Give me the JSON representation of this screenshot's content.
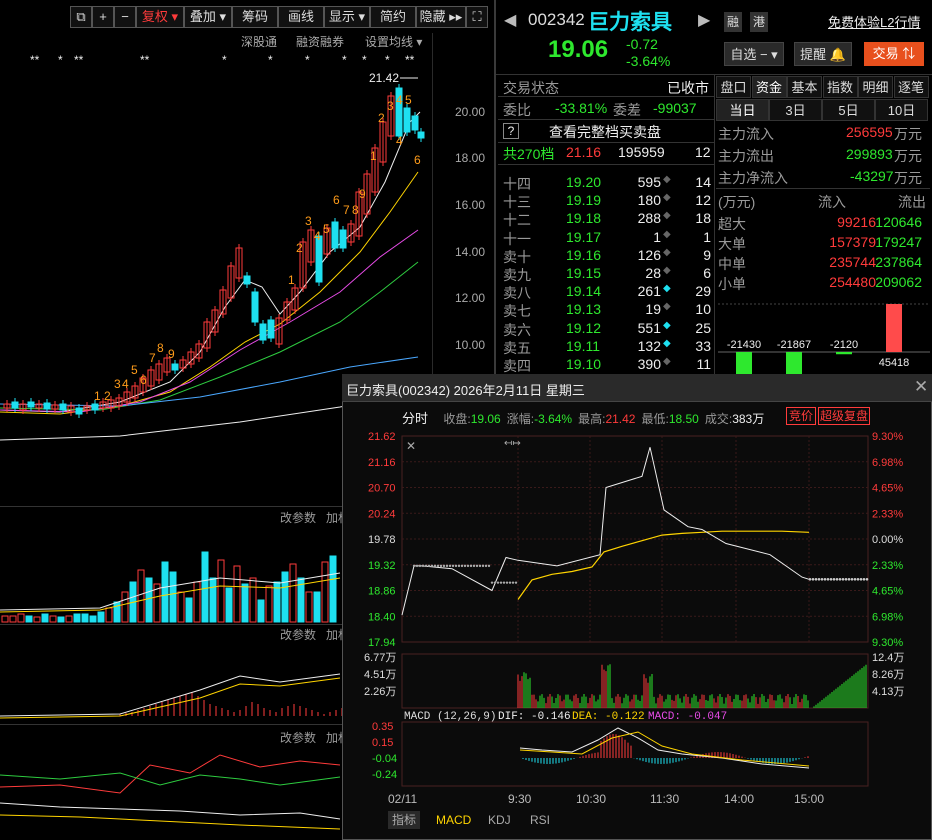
{
  "toolbar": {
    "buttons": [
      "复权",
      "叠加",
      "筹码",
      "画线",
      "显示",
      "简约",
      "隐藏"
    ],
    "sub": [
      "深股通",
      "融资融券",
      "设置均线"
    ]
  },
  "stars": [
    "**",
    "*",
    "**",
    "**",
    "*",
    "*",
    "*",
    "*",
    "*",
    "*",
    "**"
  ],
  "kline": {
    "high_label": "21.42",
    "prices": [
      "20.00",
      "18.00",
      "16.00",
      "14.00",
      "12.00",
      "10.00"
    ],
    "nums_up": [
      "1",
      "2",
      "3",
      "4",
      "5",
      "6",
      "7",
      "8",
      "9"
    ],
    "nums_top": [
      "1",
      "2",
      "3",
      "4",
      "5"
    ],
    "nums_side": [
      "4",
      "6"
    ],
    "nums_mid": [
      "1",
      "2",
      "3",
      "4",
      "5",
      "6",
      "7",
      "8",
      "9"
    ]
  },
  "panel_labels": {
    "p1": "改参数",
    "p1b": "加权",
    "p2": "改参数",
    "p2b": "加权",
    "p3": "改参数",
    "p3b": "加权"
  },
  "quote": {
    "code": "002342",
    "name": "巨力索具",
    "tag1": "融",
    "tag2": "港",
    "l2": "免费体验L2行情",
    "price": "19.06",
    "change": "-0.72",
    "pct": "-3.64%",
    "watch": "自选",
    "alert": "提醒",
    "trade": "交易"
  },
  "status": {
    "label": "交易状态",
    "value": "已收市",
    "wb_label": "委比",
    "wb": "-33.81%",
    "wc_label": "委差",
    "wc": "-99037",
    "full": "查看完整档买卖盘",
    "total_label": "共270档",
    "total_price": "21.16",
    "total_vol": "195959",
    "total_cnt": "12"
  },
  "orderbook": [
    {
      "lv": "十四",
      "p": "19.20",
      "v": "595",
      "c": "14"
    },
    {
      "lv": "十三",
      "p": "19.19",
      "v": "180",
      "c": "12"
    },
    {
      "lv": "十二",
      "p": "19.18",
      "v": "288",
      "c": "18"
    },
    {
      "lv": "十一",
      "p": "19.17",
      "v": "1",
      "c": "1"
    },
    {
      "lv": "卖十",
      "p": "19.16",
      "v": "126",
      "c": "9"
    },
    {
      "lv": "卖九",
      "p": "19.15",
      "v": "28",
      "c": "6"
    },
    {
      "lv": "卖八",
      "p": "19.14",
      "v": "261",
      "c": "29"
    },
    {
      "lv": "卖七",
      "p": "19.13",
      "v": "19",
      "c": "10"
    },
    {
      "lv": "卖六",
      "p": "19.12",
      "v": "551",
      "c": "25"
    },
    {
      "lv": "卖五",
      "p": "19.11",
      "v": "132",
      "c": "33"
    },
    {
      "lv": "卖四",
      "p": "19.10",
      "v": "390",
      "c": "11"
    }
  ],
  "right_tabs": [
    "盘口",
    "资金",
    "基本",
    "指数",
    "明细",
    "逐笔"
  ],
  "period_tabs": [
    "当日",
    "3日",
    "5日",
    "10日"
  ],
  "fund": {
    "in_label": "主力流入",
    "in": "256595",
    "out_label": "主力流出",
    "out": "299893",
    "net_label": "主力净流入",
    "net": "-43297",
    "unit": "万元",
    "hdr_unit": "(万元)",
    "hdr_in": "流入",
    "hdr_out": "流出",
    "rows": [
      {
        "k": "超大",
        "i": "99216",
        "o": "120646"
      },
      {
        "k": "大单",
        "i": "157379",
        "o": "179247"
      },
      {
        "k": "中单",
        "i": "235744",
        "o": "237864"
      },
      {
        "k": "小单",
        "i": "254480",
        "o": "209062"
      }
    ],
    "bars": [
      {
        "v": "-21430"
      },
      {
        "v": "-21867"
      },
      {
        "v": "-2120"
      },
      {
        "v": "45418"
      }
    ]
  },
  "popup": {
    "title": "巨力索具(002342) 2026年2月11日 星期三",
    "mode": "分时",
    "info": [
      {
        "k": "收盘:",
        "v": "19.06"
      },
      {
        "k": "涨幅:",
        "v": "-3.64%"
      },
      {
        "k": "最高:",
        "v": "21.42"
      },
      {
        "k": "最低:",
        "v": "18.50"
      },
      {
        "k": "成交:",
        "v": "383万"
      }
    ],
    "btn1": "竞价",
    "btn2": "超级复盘",
    "ylabels": [
      "21.62",
      "21.16",
      "20.70",
      "20.24",
      "19.78",
      "19.32",
      "18.86",
      "18.40",
      "17.94"
    ],
    "pct": [
      "9.30%",
      "6.98%",
      "4.65%",
      "2.33%",
      "0.00%",
      "2.33%",
      "4.65%",
      "6.98%",
      "9.30%"
    ],
    "vol_l": [
      "6.77万",
      "4.51万",
      "2.26万"
    ],
    "vol_r": [
      "12.4万",
      "8.26万",
      "4.13万"
    ],
    "macd_label": "MACD (12,26,9)",
    "dif": "DIF: -0.146",
    "dea": "DEA: -0.122",
    "macd": "MACD: -0.047",
    "macd_y": [
      "0.35",
      "0.15",
      "-0.04",
      "-0.24"
    ],
    "xaxis": [
      "02/11",
      "9:30",
      "10:30",
      "11:30",
      "14:00",
      "15:00"
    ],
    "bottom_tabs": [
      "指标",
      "MACD",
      "KDJ",
      "RSI"
    ]
  },
  "chart_data": {
    "type": "line",
    "title": "巨力索具(002342) 2026年2月11日 星期三",
    "series": [
      {
        "name": "price",
        "values": [
          18.42,
          19.3,
          19.3,
          19.25,
          18.86,
          19.45,
          19.4,
          19.3,
          19.5,
          20.7,
          20.9,
          21.42,
          20.3,
          20.0,
          19.95,
          19.7,
          19.5,
          19.1,
          19.06
        ]
      },
      {
        "name": "avg",
        "values": [
          18.7,
          19.05,
          19.15,
          19.2,
          19.28,
          19.55,
          19.65,
          19.75,
          19.85,
          19.88,
          19.9,
          19.92,
          19.92,
          19.92,
          19.9
        ]
      }
    ],
    "ylim": [
      17.94,
      21.62
    ]
  }
}
